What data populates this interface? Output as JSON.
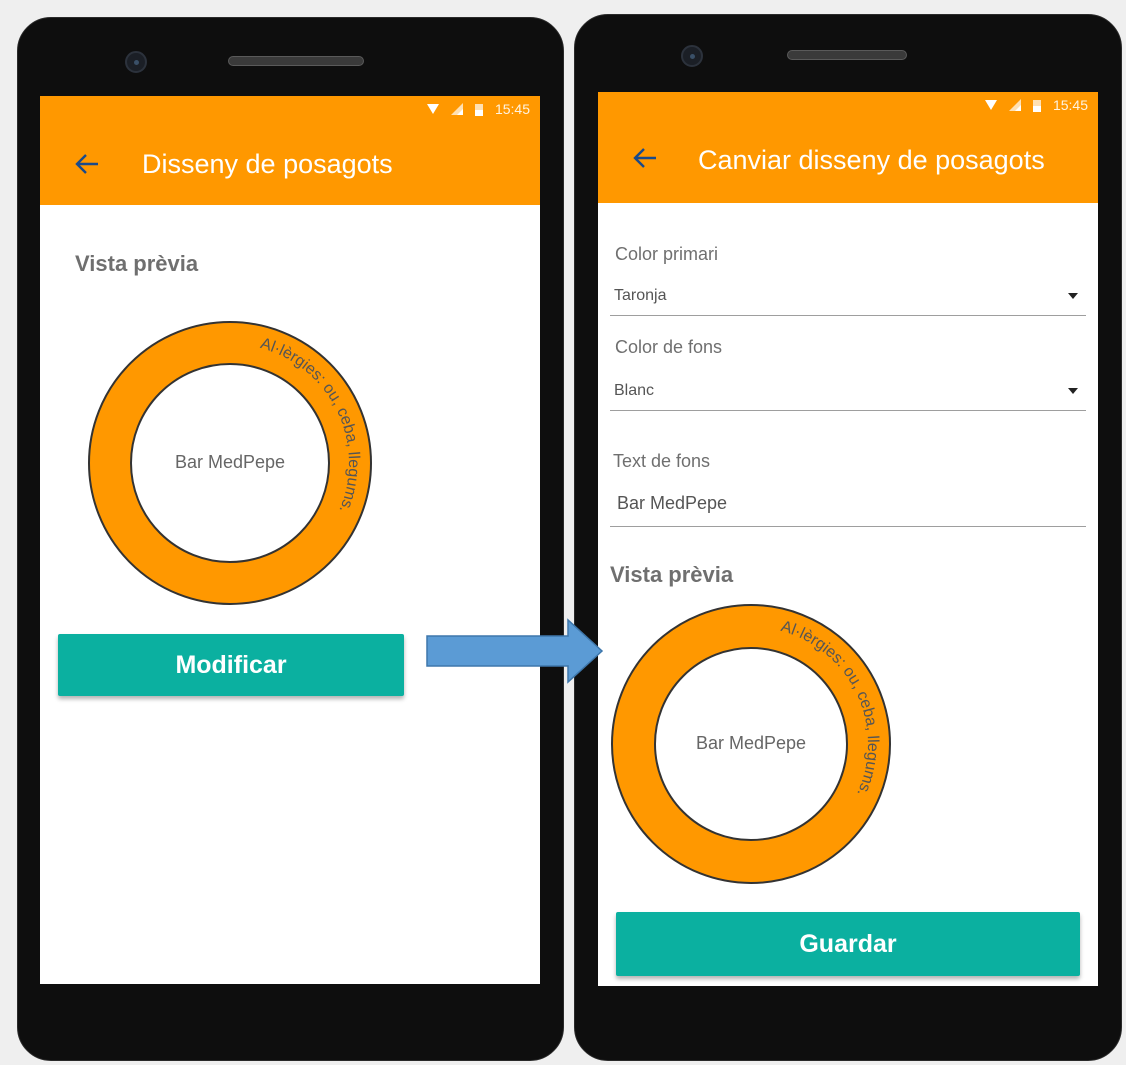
{
  "colors": {
    "primary": "#ff9800",
    "accent": "#0bb0a0",
    "arrow": "#5b9bd5"
  },
  "left_screen": {
    "status": {
      "time": "15:45"
    },
    "appbar": {
      "title": "Disseny de posagots",
      "back_icon": "arrow-left-icon"
    },
    "preview_title": "Vista prèvia",
    "coaster": {
      "center_text": "Bar MedPepe",
      "ring_text": "Al·lèrgies: ou, ceba, llegums."
    },
    "button_label": "Modificar"
  },
  "right_screen": {
    "status": {
      "time": "15:45"
    },
    "appbar": {
      "title": "Canviar disseny de posagots",
      "back_icon": "arrow-left-icon"
    },
    "primary_color": {
      "label": "Color primari",
      "value": "Taronja"
    },
    "background_color": {
      "label": "Color de fons",
      "value": "Blanc"
    },
    "background_text": {
      "label": "Text de fons",
      "value": "Bar MedPepe"
    },
    "preview_title": "Vista prèvia",
    "coaster": {
      "center_text": "Bar MedPepe",
      "ring_text": "Al·lèrgies: ou, ceba, llegums."
    },
    "button_label": "Guardar"
  }
}
